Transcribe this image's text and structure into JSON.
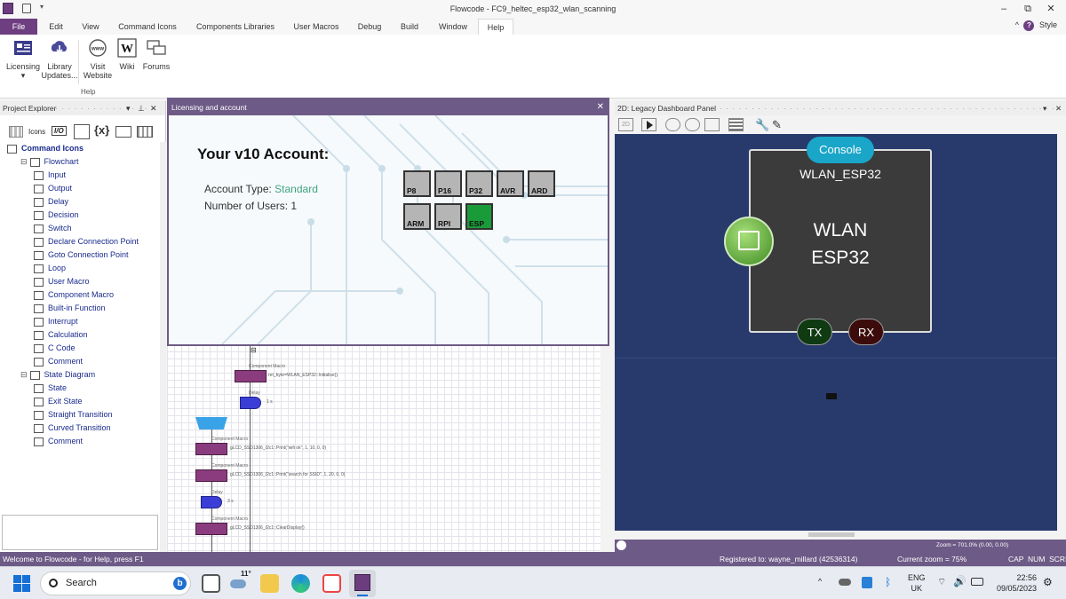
{
  "window": {
    "title": "Flowcode - FC9_heltec_esp32_wlan_scanning",
    "minimize": "–",
    "maximize": "⧉",
    "close": "✕"
  },
  "menu": {
    "items": [
      "File",
      "Edit",
      "View",
      "Command Icons",
      "Components Libraries",
      "User Macros",
      "Debug",
      "Build",
      "Window",
      "Help"
    ],
    "style_label": "Style",
    "caret": "^"
  },
  "ribbon": {
    "buttons": [
      {
        "label": "Licensing",
        "sub": "▾"
      },
      {
        "label": "Library\nUpdates..."
      },
      {
        "label": "Visit\nWebsite"
      },
      {
        "label": "Wiki"
      },
      {
        "label": "Forums"
      }
    ],
    "group_label": "Help"
  },
  "project_explorer": {
    "title": "Project Explorer",
    "toolbar": {
      "icons_label": "Icons",
      "io_label": "I/O",
      "vars_label": "{x}"
    },
    "tree": [
      {
        "label": "Command Icons",
        "level": 0,
        "header": true
      },
      {
        "label": "Flowchart",
        "level": 1
      },
      {
        "label": "Input",
        "level": 2
      },
      {
        "label": "Output",
        "level": 2
      },
      {
        "label": "Delay",
        "level": 2
      },
      {
        "label": "Decision",
        "level": 2
      },
      {
        "label": "Switch",
        "level": 2
      },
      {
        "label": "Declare Connection Point",
        "level": 2
      },
      {
        "label": "Goto Connection Point",
        "level": 2
      },
      {
        "label": "Loop",
        "level": 2
      },
      {
        "label": "User Macro",
        "level": 2
      },
      {
        "label": "Component Macro",
        "level": 2
      },
      {
        "label": "Built-in Function",
        "level": 2
      },
      {
        "label": "Interrupt",
        "level": 2
      },
      {
        "label": "Calculation",
        "level": 2
      },
      {
        "label": "C Code",
        "level": 2
      },
      {
        "label": "Comment",
        "level": 2
      },
      {
        "label": "State Diagram",
        "level": 1
      },
      {
        "label": "State",
        "level": 2
      },
      {
        "label": "Exit State",
        "level": 2
      },
      {
        "label": "Straight Transition",
        "level": 2
      },
      {
        "label": "Curved Transition",
        "level": 2
      },
      {
        "label": "Comment",
        "level": 2
      }
    ]
  },
  "dialog": {
    "title": "Licensing and account",
    "heading": "Your v10 Account:",
    "account_type_label": "Account Type:",
    "account_type_value": "Standard",
    "users_label": "Number of Users:",
    "users_value": "1",
    "chips": [
      {
        "label": "P8",
        "active": false
      },
      {
        "label": "P16",
        "active": false
      },
      {
        "label": "P32",
        "active": false
      },
      {
        "label": "AVR",
        "active": false
      },
      {
        "label": "ARD",
        "active": false
      },
      {
        "label": "ARM",
        "active": false
      },
      {
        "label": "RPI",
        "active": false
      },
      {
        "label": "ESP",
        "active": true
      }
    ]
  },
  "flowchart": {
    "blocks": [
      {
        "kind": "macro",
        "label": "Component Macro",
        "text": "ret_byte=WLAN_ESP32::Initialise()"
      },
      {
        "kind": "delay",
        "label": "Delay",
        "text": "1 s"
      },
      {
        "kind": "loop"
      },
      {
        "kind": "macro",
        "label": "Component Macro",
        "text": "gLCD_SSD1306_I2c1::Print(\"wifi ok\", 1, 10, 0, 0)"
      },
      {
        "kind": "macro",
        "label": "Component Macro",
        "text": "gLCD_SSD1306_I2c1::Print(\"search for SSID\", 1, 20, 0, 0)"
      },
      {
        "kind": "delay",
        "label": "Delay",
        "text": "3 s"
      },
      {
        "kind": "macro",
        "label": "Component Macro",
        "text": "gLCD_SSD1306_I2c1::ClearDisplay()"
      }
    ]
  },
  "dashboard": {
    "title": "2D: Legacy Dashboard Panel",
    "console_label": "Console",
    "component_name": "WLAN_ESP32",
    "component_big_line1": "WLAN",
    "component_big_line2": "ESP32",
    "tx_label": "TX",
    "rx_label": "RX",
    "zoom_status": "Zoom = 701.0% (0.00, 0.00)"
  },
  "statusbar": {
    "welcome": "Welcome to Flowcode - for Help, press F1",
    "registered": "Registered to: wayne_millard (42536314)",
    "current_zoom": "Current zoom = 75%",
    "keys": "CAP  NUM  SCRL"
  },
  "taskbar": {
    "search_label": "Search",
    "weather_temp": "11°",
    "lang_line1": "ENG",
    "lang_line2": "UK",
    "time": "22:56",
    "date": "09/05/2023"
  },
  "colors": {
    "accent": "#6d3f80",
    "panel_header": "#6d5a86",
    "dashboard_bg": "#283a6c",
    "standard_text": "#3fa47d",
    "chip_active": "#1a9b3a",
    "console_pill": "#1aa6c8"
  }
}
